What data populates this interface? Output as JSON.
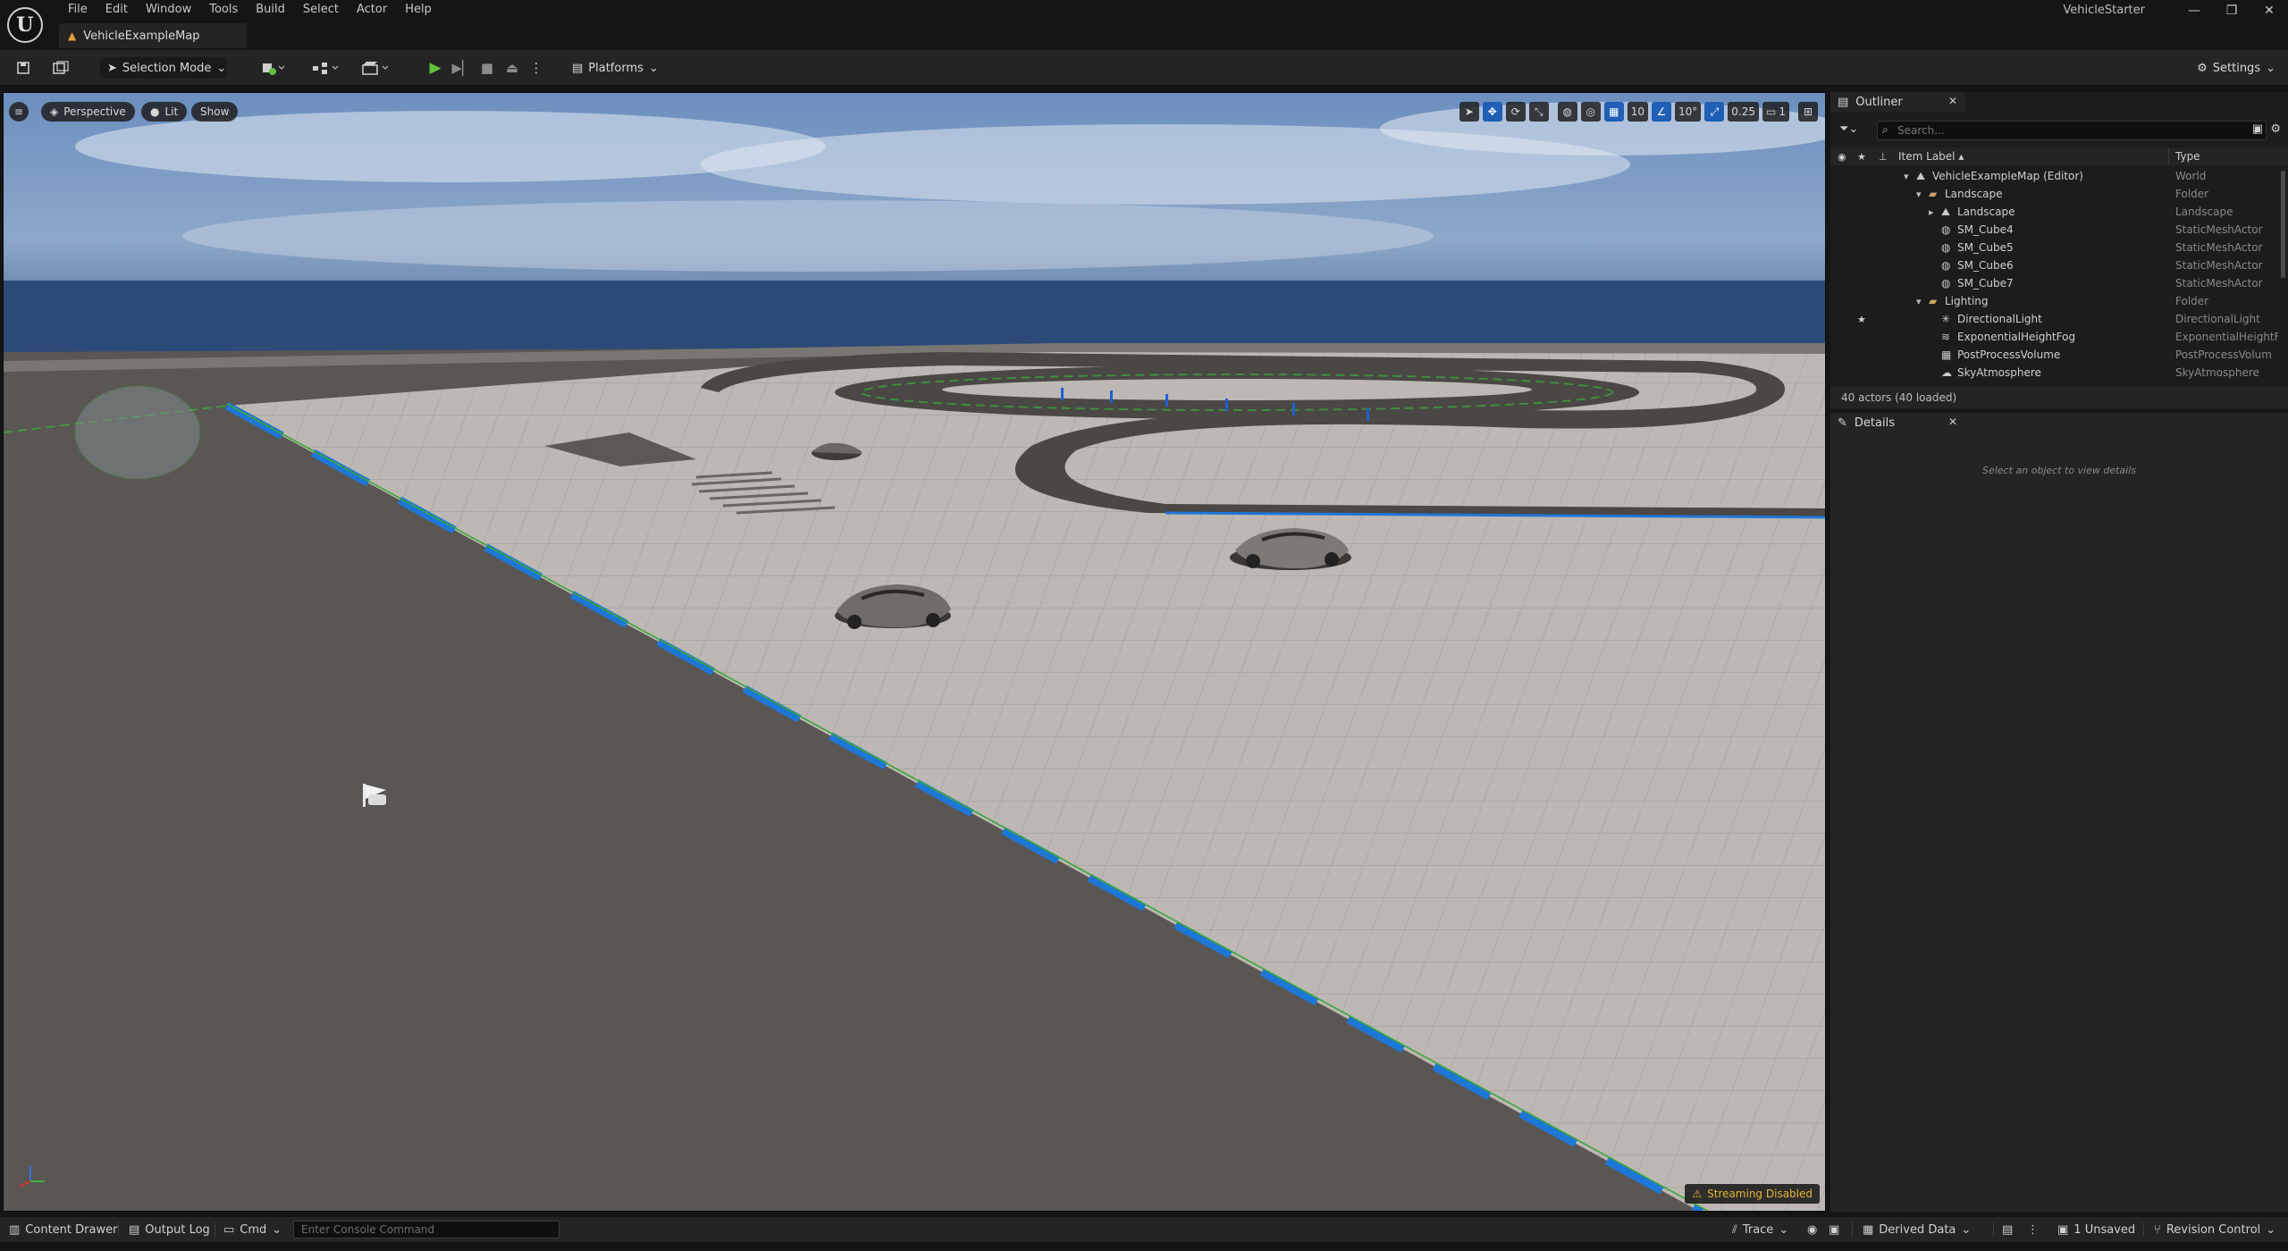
{
  "app": {
    "project_name": "VehicleStarter",
    "logo_letter": "U"
  },
  "menu": [
    "File",
    "Edit",
    "Window",
    "Tools",
    "Build",
    "Select",
    "Actor",
    "Help"
  ],
  "document_tab": {
    "label": "VehicleExampleMap"
  },
  "window_controls": {
    "minimize": "—",
    "restore": "❐",
    "close": "✕"
  },
  "toolbar": {
    "selection_mode": "Selection Mode",
    "platforms": "Platforms",
    "settings": "Settings"
  },
  "viewport": {
    "hamburger": "≡",
    "perspective": "Perspective",
    "lit": "Lit",
    "show": "Show",
    "grid_snap": "10",
    "rotation_snap": "10°",
    "scale_snap": "0.25",
    "camera_speed": "1",
    "streaming_status": "Streaming Disabled"
  },
  "outliner": {
    "tab_label": "Outliner",
    "search_placeholder": "Search...",
    "col_label": "Item Label",
    "col_type": "Type",
    "rows": [
      {
        "label": "VehicleExampleMap (Editor)",
        "type": "World",
        "indent": 0,
        "expander": "▾",
        "icon": "world-icon",
        "pinned": false
      },
      {
        "label": "Landscape",
        "type": "Folder",
        "indent": 1,
        "expander": "▾",
        "icon": "folder-icon",
        "pinned": false
      },
      {
        "label": "Landscape",
        "type": "Landscape",
        "indent": 2,
        "expander": "▸",
        "icon": "landscape-icon",
        "pinned": false
      },
      {
        "label": "SM_Cube4",
        "type": "StaticMeshActor",
        "indent": 2,
        "expander": "",
        "icon": "static-mesh-icon",
        "pinned": false
      },
      {
        "label": "SM_Cube5",
        "type": "StaticMeshActor",
        "indent": 2,
        "expander": "",
        "icon": "static-mesh-icon",
        "pinned": false
      },
      {
        "label": "SM_Cube6",
        "type": "StaticMeshActor",
        "indent": 2,
        "expander": "",
        "icon": "static-mesh-icon",
        "pinned": false
      },
      {
        "label": "SM_Cube7",
        "type": "StaticMeshActor",
        "indent": 2,
        "expander": "",
        "icon": "static-mesh-icon",
        "pinned": false
      },
      {
        "label": "Lighting",
        "type": "Folder",
        "indent": 1,
        "expander": "▾",
        "icon": "folder-icon",
        "pinned": false
      },
      {
        "label": "DirectionalLight",
        "type": "DirectionalLight",
        "indent": 2,
        "expander": "",
        "icon": "light-icon",
        "pinned": true
      },
      {
        "label": "ExponentialHeightFog",
        "type": "ExponentialHeightFo",
        "indent": 2,
        "expander": "",
        "icon": "fog-icon",
        "pinned": false
      },
      {
        "label": "PostProcessVolume",
        "type": "PostProcessVolum",
        "indent": 2,
        "expander": "",
        "icon": "volume-icon",
        "pinned": false
      },
      {
        "label": "SkyAtmosphere",
        "type": "SkyAtmosphere",
        "indent": 2,
        "expander": "",
        "icon": "sky-icon",
        "pinned": false
      }
    ],
    "footer": "40 actors (40 loaded)"
  },
  "details": {
    "tab_label": "Details",
    "empty_text": "Select an object to view details"
  },
  "statusbar": {
    "content_drawer": "Content Drawer",
    "output_log": "Output Log",
    "cmd": "Cmd",
    "console_placeholder": "Enter Console Command",
    "trace": "Trace",
    "derived_data": "Derived Data",
    "unsaved": "1 Unsaved",
    "revision_control": "Revision Control"
  },
  "colors": {
    "accent_blue": "#1f5fb5",
    "play_green": "#5ec23c",
    "warning_yellow": "#e6b530",
    "map_icon_orange": "#e2a33a"
  }
}
